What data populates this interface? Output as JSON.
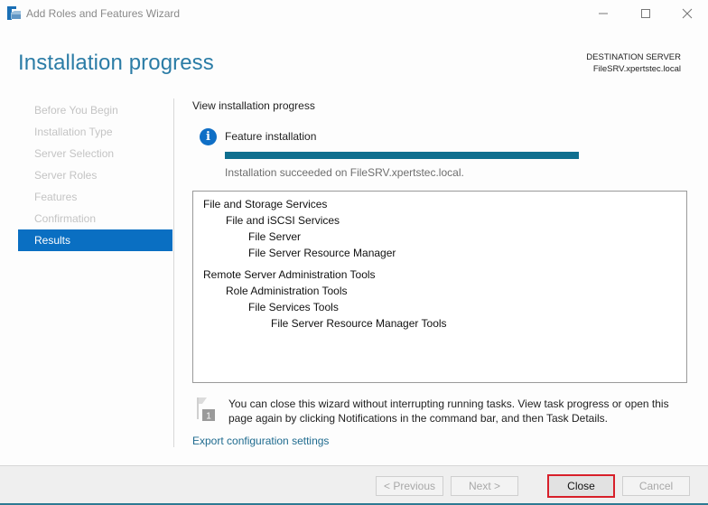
{
  "window": {
    "title": "Add Roles and Features Wizard",
    "icon": "server-manager-icon",
    "controls": {
      "minimize_icon": "minimize-icon",
      "maximize_icon": "maximize-icon",
      "close_icon": "close-icon"
    }
  },
  "header": {
    "page_title": "Installation progress",
    "destination_label": "DESTINATION SERVER",
    "destination_server": "FileSRV.xpertstec.local"
  },
  "sidebar": {
    "items": [
      {
        "label": "Before You Begin",
        "active": false
      },
      {
        "label": "Installation Type",
        "active": false
      },
      {
        "label": "Server Selection",
        "active": false
      },
      {
        "label": "Server Roles",
        "active": false
      },
      {
        "label": "Features",
        "active": false
      },
      {
        "label": "Confirmation",
        "active": false
      },
      {
        "label": "Results",
        "active": true
      }
    ]
  },
  "main": {
    "section_label": "View installation progress",
    "feature_label": "Feature installation",
    "progress_percent": 100,
    "status_text": "Installation succeeded on FileSRV.xpertstec.local.",
    "results": [
      {
        "text": "File and Storage Services",
        "level": 0
      },
      {
        "text": "File and iSCSI Services",
        "level": 1
      },
      {
        "text": "File Server",
        "level": 2
      },
      {
        "text": "File Server Resource Manager",
        "level": 2
      },
      {
        "text": "Remote Server Administration Tools",
        "level": 0
      },
      {
        "text": "Role Administration Tools",
        "level": 1
      },
      {
        "text": "File Services Tools",
        "level": 2
      },
      {
        "text": "File Server Resource Manager Tools",
        "level": 3
      }
    ],
    "note": "You can close this wizard without interrupting running tasks. View task progress or open this page again by clicking Notifications in the command bar, and then Task Details.",
    "notification_badge": "1",
    "export_link": "Export configuration settings"
  },
  "footer": {
    "previous_label": "< Previous",
    "next_label": "Next >",
    "close_label": "Close",
    "cancel_label": "Cancel"
  },
  "colors": {
    "accent": "#0a6fc2",
    "title": "#2b7ca6",
    "progress": "#0f6f8f",
    "highlight_border": "#d8202a"
  }
}
